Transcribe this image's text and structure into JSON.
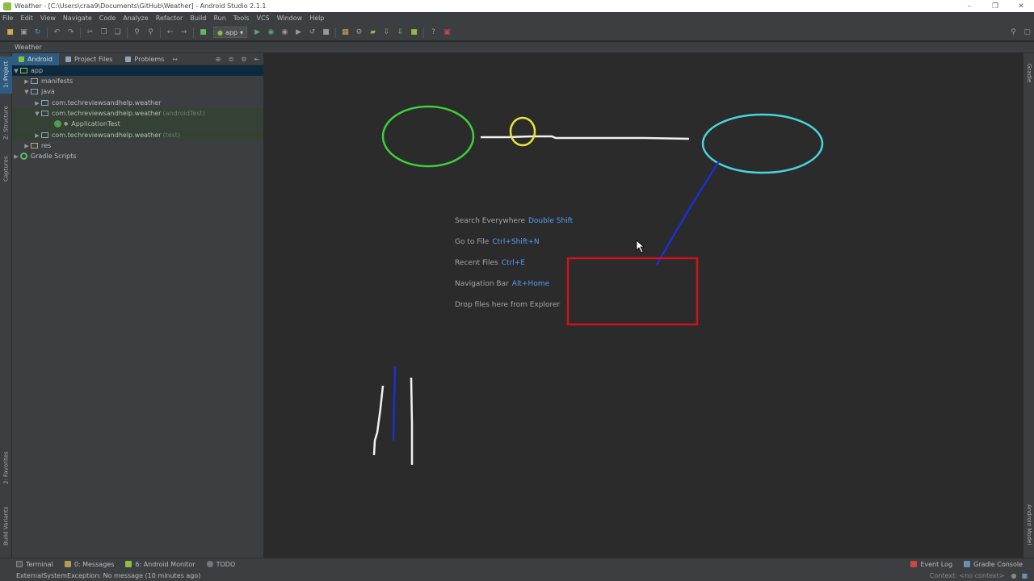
{
  "window": {
    "title": "Weather - [C:\\Users\\craa9\\Documents\\GitHub\\Weather] - Android Studio 2.1.1",
    "minimize": "–",
    "restore": "❐",
    "close": "✕"
  },
  "menu": [
    "File",
    "Edit",
    "View",
    "Navigate",
    "Code",
    "Analyze",
    "Refactor",
    "Build",
    "Run",
    "Tools",
    "VCS",
    "Window",
    "Help"
  ],
  "toolbar": {
    "run_config": "app"
  },
  "navbar": {
    "project": "Weather"
  },
  "left_tabs": {
    "project": "1: Project",
    "structure": "Z: Structure",
    "captures": "Captures",
    "favorites": "2: Favorites",
    "build_variants": "Build Variants"
  },
  "right_tabs": {
    "gradle": "Gradle",
    "android_model": "Android Model"
  },
  "panel_tabs": [
    "Android",
    "Project Files",
    "Problems"
  ],
  "tree": [
    {
      "label": "app",
      "suffix": ""
    },
    {
      "label": "manifests",
      "suffix": ""
    },
    {
      "label": "java",
      "suffix": ""
    },
    {
      "label": "com.techreviewsandhelp.weather",
      "suffix": ""
    },
    {
      "label": "com.techreviewsandhelp.weather",
      "suffix": "(androidTest)"
    },
    {
      "label": "ApplicationTest",
      "suffix": ""
    },
    {
      "label": "com.techreviewsandhelp.weather",
      "suffix": "(test)"
    },
    {
      "label": "res",
      "suffix": ""
    },
    {
      "label": "Gradle Scripts",
      "suffix": ""
    }
  ],
  "editor_hints": [
    {
      "label": "Search Everywhere",
      "key": "Double Shift"
    },
    {
      "label": "Go to File",
      "key": "Ctrl+Shift+N"
    },
    {
      "label": "Recent Files",
      "key": "Ctrl+E"
    },
    {
      "label": "Navigation Bar",
      "key": "Alt+Home"
    },
    {
      "label": "Drop files here from Explorer",
      "key": ""
    }
  ],
  "annotation_colors": {
    "green": "#3bd23b",
    "yellow": "#e8e83a",
    "cyan": "#47d6dc",
    "blue": "#1c2fd6",
    "red": "#d0121b",
    "white": "#f2f2f2"
  },
  "bottom_tabs": [
    "Terminal",
    "0: Messages",
    "6: Android Monitor",
    "TODO"
  ],
  "bottom_right_tabs": [
    "Event Log",
    "Gradle Console"
  ],
  "status": {
    "message": "ExternalSystemException: No message (10 minutes ago)",
    "context": "Context: <no context>"
  }
}
